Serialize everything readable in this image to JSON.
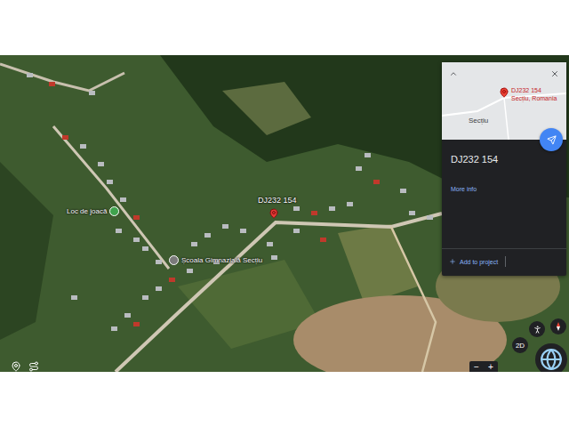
{
  "map": {
    "labels": [
      {
        "text": "Loc de joacă",
        "kind": "poi",
        "color": "#3fa34d"
      },
      {
        "text": "Școala Gimnazială Secțiu",
        "kind": "poi",
        "color": "#7a7a7a"
      },
      {
        "text": "DJ232 154",
        "kind": "pin",
        "color": "#e53935"
      }
    ]
  },
  "panel": {
    "minimap": {
      "pin_label": "DJ232 154",
      "pin_sublabel": "Secțiu, Romania",
      "place_label": "Secțiu"
    },
    "title": "DJ232 154",
    "link": "More info",
    "action": "Add to project"
  },
  "controls": {
    "view_toggle": "2D",
    "zoom_out": "−",
    "zoom_in": "+"
  }
}
